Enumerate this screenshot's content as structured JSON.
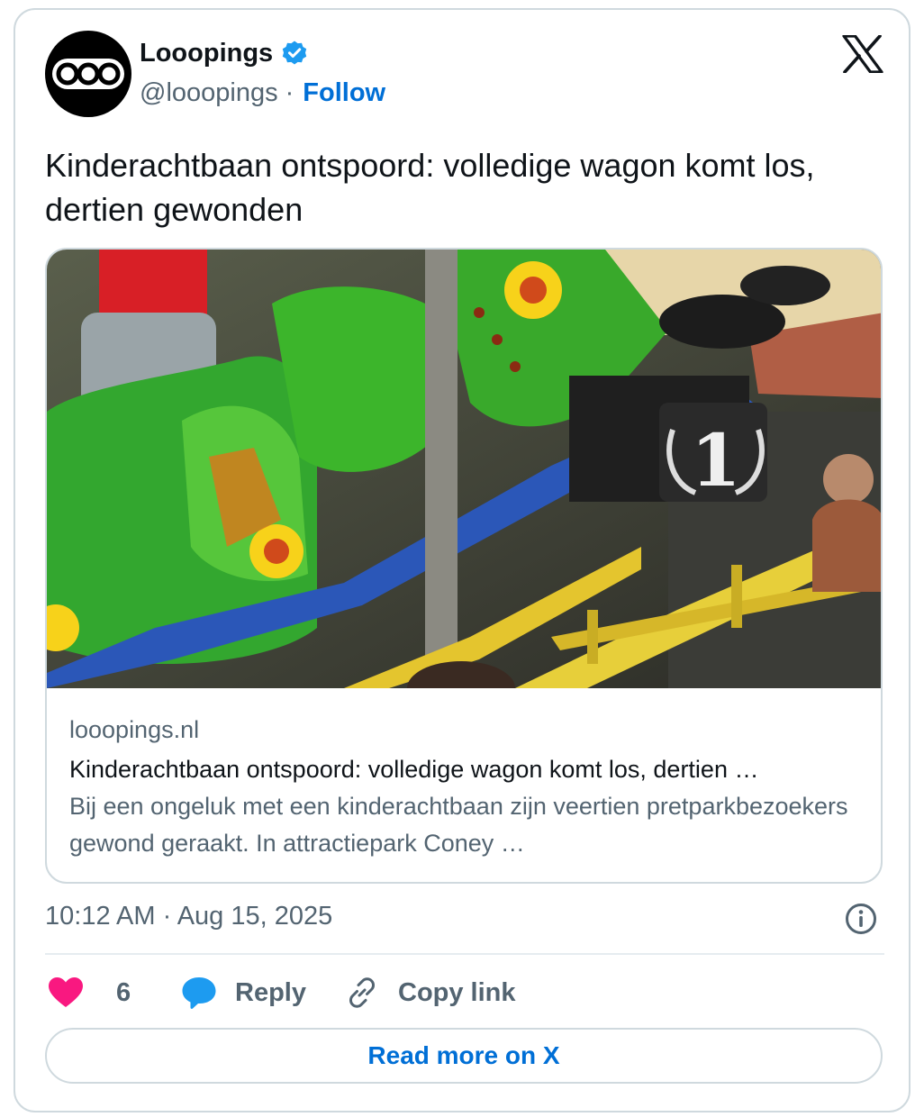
{
  "author": {
    "display_name": "Looopings",
    "handle": "@looopings",
    "separator": "·",
    "follow_label": "Follow",
    "verified": true,
    "avatar_icon": "three-circles-logo-icon"
  },
  "brand_icon": "x-logo-icon",
  "tweet": {
    "text": "Kinderachtbaan ontspoord: volledige wagon komt los, dertien gewonden"
  },
  "link_card": {
    "image_icon": "roller-coaster-photo",
    "domain": "looopings.nl",
    "title": "Kinderachtbaan ontspoord: volledige wagon komt los, dertien …",
    "description": "Bij een ongeluk met een kinderachtbaan zijn veertien pretparkbezoekers gewond geraakt. In attractiepark Coney …"
  },
  "meta": {
    "timestamp": "10:12 AM · Aug 15, 2025",
    "info_icon": "info-icon"
  },
  "actions": {
    "likes_count": "6",
    "reply_label": "Reply",
    "copy_link_label": "Copy link"
  },
  "read_more_label": "Read more on X",
  "colors": {
    "accent": "#006fd6",
    "like": "#f91880",
    "reply": "#1d9bf0",
    "verified": "#1d9bf0",
    "secondary_text": "#536471",
    "border": "#cfd9de"
  }
}
